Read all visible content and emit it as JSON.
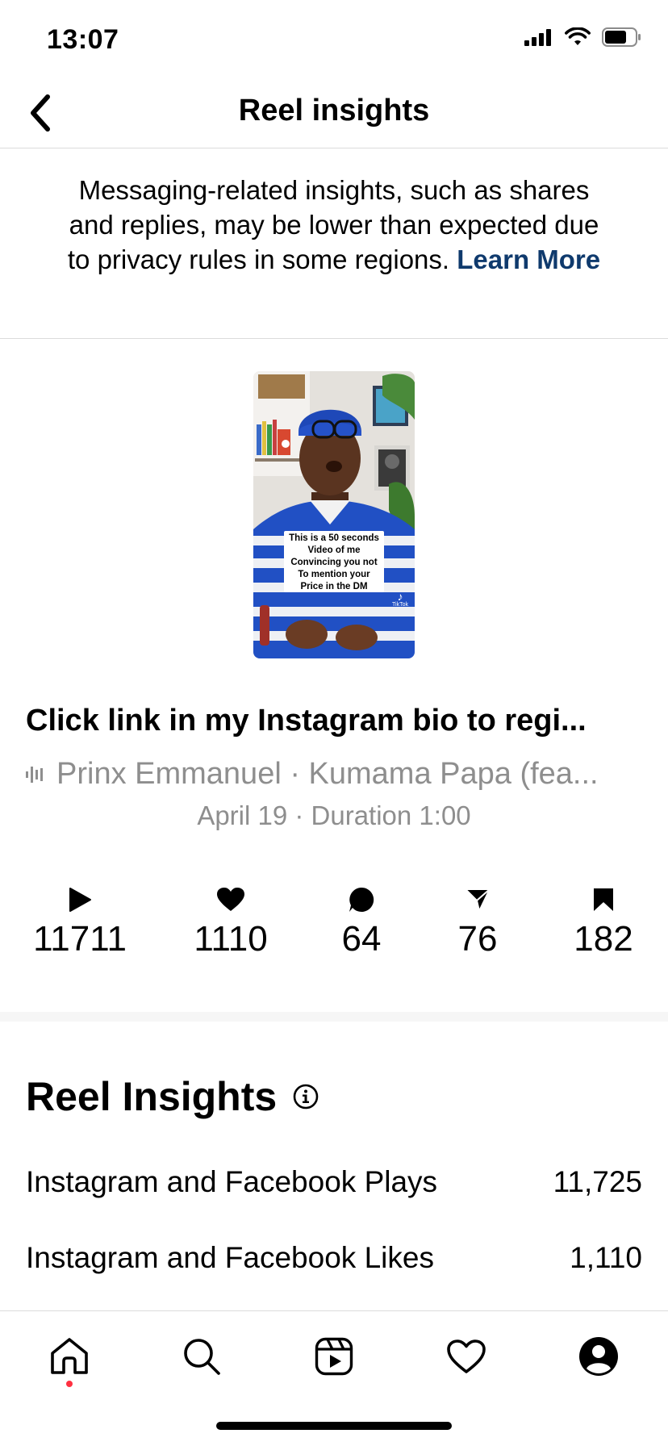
{
  "status_bar": {
    "time": "13:07"
  },
  "nav": {
    "title": "Reel insights"
  },
  "notice": {
    "text": "Messaging-related insights, such as shares and replies, may be lower than expected due to privacy rules in some regions.",
    "link": "Learn More"
  },
  "thumbnail": {
    "overlay_lines": [
      "This is a 50 seconds",
      "Video of me",
      "Convincing you not",
      "To mention your",
      "Price in the DM"
    ],
    "watermark": "TikTok"
  },
  "reel": {
    "caption": "Click link in my Instagram bio to regi...",
    "audio": "Prinx Emmanuel · Kumama Papa (fea...",
    "meta": "April 19 · Duration 1:00"
  },
  "stats": [
    {
      "icon": "play-icon",
      "value": "11711"
    },
    {
      "icon": "heart-icon",
      "value": "1110"
    },
    {
      "icon": "comment-icon",
      "value": "64"
    },
    {
      "icon": "share-icon",
      "value": "76"
    },
    {
      "icon": "bookmark-icon",
      "value": "182"
    }
  ],
  "insights": {
    "title": "Reel Insights",
    "rows": [
      {
        "label": "Instagram and Facebook Plays",
        "value": "11,725"
      },
      {
        "label": "Instagram and Facebook Likes",
        "value": "1,110"
      }
    ]
  },
  "tabs": [
    "home-icon",
    "search-icon",
    "reels-icon",
    "activity-heart-icon",
    "profile-icon"
  ],
  "colors": {
    "link": "#0f3a6d",
    "muted": "#8e8e8e",
    "notification_dot": "#ff3040"
  }
}
